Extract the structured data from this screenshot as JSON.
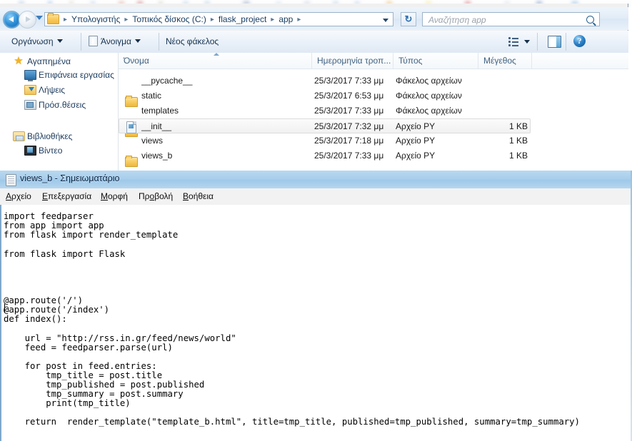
{
  "explorer": {
    "address": {
      "back_tooltip": "Πίσω",
      "forward_tooltip": "Εμπρός",
      "breadcrumbs": [
        "Υπολογιστής",
        "Τοπικός δίσκος (C:)",
        "flask_project",
        "app"
      ],
      "separator": "▶",
      "refresh_label": "↻"
    },
    "search": {
      "placeholder": "Αναζήτηση app"
    },
    "toolbar": {
      "organize_label": "Οργάνωση",
      "open_label": "Άνοιγμα",
      "new_folder_label": "Νέος φάκελος",
      "help_label": "?"
    },
    "nav_pane": {
      "groups": [
        {
          "label": "Αγαπημένα",
          "icon": "star-icon",
          "items": [
            {
              "label": "Επιφάνεια εργασίας",
              "icon": "desktop-icon"
            },
            {
              "label": "Λήψεις",
              "icon": "downloads-icon"
            },
            {
              "label": "Πρόσ.θέσεις",
              "icon": "recent-places-icon"
            }
          ]
        },
        {
          "label": "Βιβλιοθήκες",
          "icon": "libraries-icon",
          "items": [
            {
              "label": "Βίντεο",
              "icon": "video-icon"
            }
          ]
        }
      ]
    },
    "file_list": {
      "columns": [
        "Όνομα",
        "Ημερομηνία τροπ...",
        "Τύπος",
        "Μέγεθος"
      ],
      "sort_column": 0,
      "rows": [
        {
          "name": "__pycache__",
          "date": "25/3/2017 7:33 μμ",
          "type": "Φάκελος αρχείων",
          "size": "",
          "icon": "folder-icon",
          "selected": false
        },
        {
          "name": "static",
          "date": "25/3/2017 6:53 μμ",
          "type": "Φάκελος αρχείων",
          "size": "",
          "icon": "folder-icon",
          "selected": false
        },
        {
          "name": "templates",
          "date": "25/3/2017 7:33 μμ",
          "type": "Φάκελος αρχείων",
          "size": "",
          "icon": "folder-icon",
          "selected": false
        },
        {
          "name": "__init__",
          "date": "25/3/2017 7:32 μμ",
          "type": "Αρχείο PY",
          "size": "1 KB",
          "icon": "python-file-icon",
          "selected": true
        },
        {
          "name": "views",
          "date": "25/3/2017 7:18 μμ",
          "type": "Αρχείο PY",
          "size": "1 KB",
          "icon": "python-file-icon",
          "selected": false
        },
        {
          "name": "views_b",
          "date": "25/3/2017 7:33 μμ",
          "type": "Αρχείο PY",
          "size": "1 KB",
          "icon": "python-file-icon",
          "selected": false
        }
      ]
    }
  },
  "notepad": {
    "title": "views_b - Σημειωματάριο",
    "menu": [
      "Αρχείο",
      "Επεξεργασία",
      "Μορφή",
      "Προβολή",
      "Βοήθεια"
    ],
    "content": "import feedparser\nfrom app import app\nfrom flask import render_template\n\nfrom flask import Flask\n\n\n\n\n@app.route('/')\n@app.route('/index')\ndef index():\n\n    url = \"http://rss.in.gr/feed/news/world\"\n    feed = feedparser.parse(url)\n\n    for post in feed.entries:\n        tmp_title = post.title\n        tmp_published = post.published\n        tmp_summary = post.summary\n        print(tmp_title)\n\n    return  render_template(\"template_b.html\", title=tmp_title, published=tmp_published, summary=tmp_summary)"
  },
  "colors": {
    "accent": "#2d7ebb",
    "titlebar": "#a9cfec",
    "selection": "#f1f1f1",
    "column_header_text": "#41617f"
  }
}
